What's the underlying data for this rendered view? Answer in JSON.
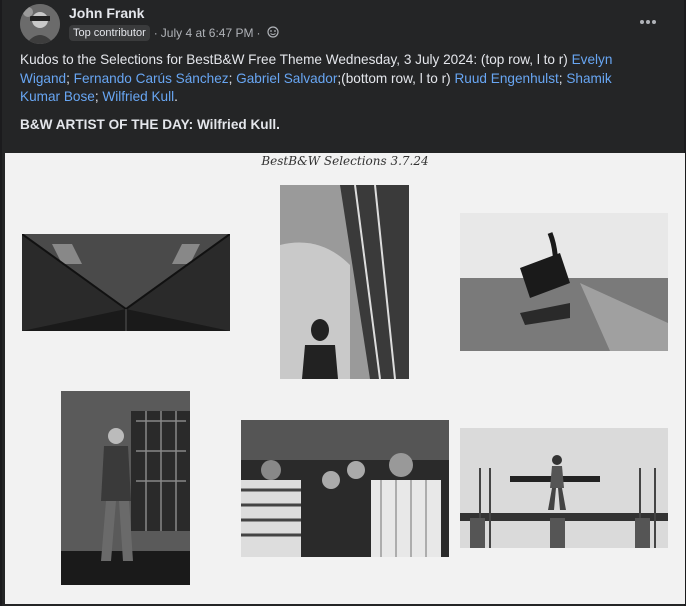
{
  "post": {
    "author": "John Frank",
    "badge": "Top contributor",
    "separator": "·",
    "timestamp": "July 4 at 6:47 PM",
    "privacy_icon": "friends-globe-icon",
    "more_icon": "more-dots-icon",
    "caption_prefix": "Kudos to the Selections for BestB&W Free Theme Wednesday, 3 July 2024: (top row, l to r) ",
    "artists": {
      "a1": "Evelyn Wigand",
      "a2": "Fernando Carús Sánchez",
      "a3": "Gabriel Salvador",
      "a4": "Ruud Engenhulst",
      "a5": "Shamik Kumar Bose",
      "a6": "Wilfried Kull"
    },
    "bottom_row_text": ";(bottom row, l to r) ",
    "semicolon": "; ",
    "period": ".",
    "artist_of_day": "B&W ARTIST OF THE DAY: Wilfried Kull."
  },
  "collage": {
    "title": "BestB&W Selections 3.7.24"
  }
}
